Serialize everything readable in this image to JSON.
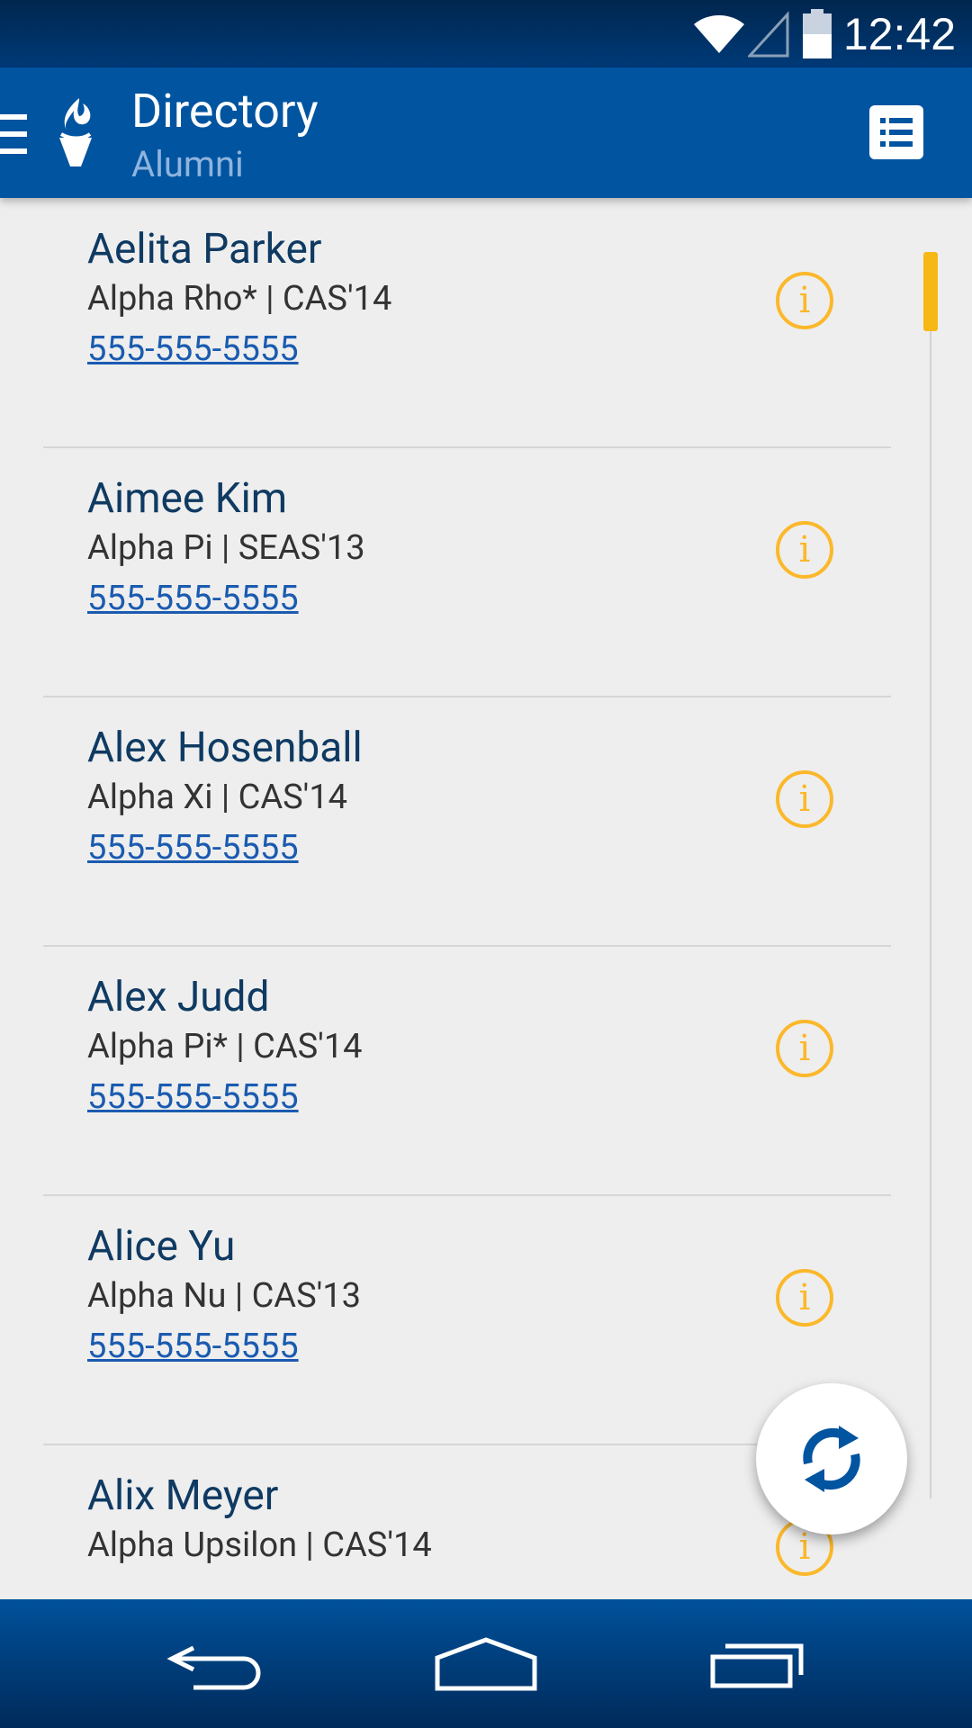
{
  "status_bar": {
    "time": "12:42"
  },
  "app_bar": {
    "title": "Directory",
    "subtitle": "Alumni"
  },
  "list": {
    "items": [
      {
        "name": "Aelita Parker",
        "meta": "Alpha Rho* | CAS'14",
        "phone": "555-555-5555"
      },
      {
        "name": "Aimee Kim",
        "meta": "Alpha Pi | SEAS'13",
        "phone": "555-555-5555"
      },
      {
        "name": "Alex Hosenball",
        "meta": "Alpha Xi | CAS'14",
        "phone": "555-555-5555"
      },
      {
        "name": "Alex Judd",
        "meta": "Alpha Pi* | CAS'14",
        "phone": "555-555-5555"
      },
      {
        "name": "Alice Yu",
        "meta": "Alpha Nu | CAS'13",
        "phone": "555-555-5555"
      },
      {
        "name": "Alix Meyer",
        "meta": "Alpha Upsilon | CAS'14",
        "phone": ""
      }
    ],
    "info_icon_glyph": "i"
  },
  "colors": {
    "primary": "#0154a0",
    "accent": "#fbb82b",
    "link": "#1a5bb0"
  },
  "icons": {
    "menu": "hamburger-icon",
    "logo": "torch-logo",
    "view_toggle": "list-view-icon",
    "info": "info-icon",
    "refresh": "refresh-icon",
    "back": "back-icon",
    "home": "home-icon",
    "recents": "recent-apps-icon"
  }
}
